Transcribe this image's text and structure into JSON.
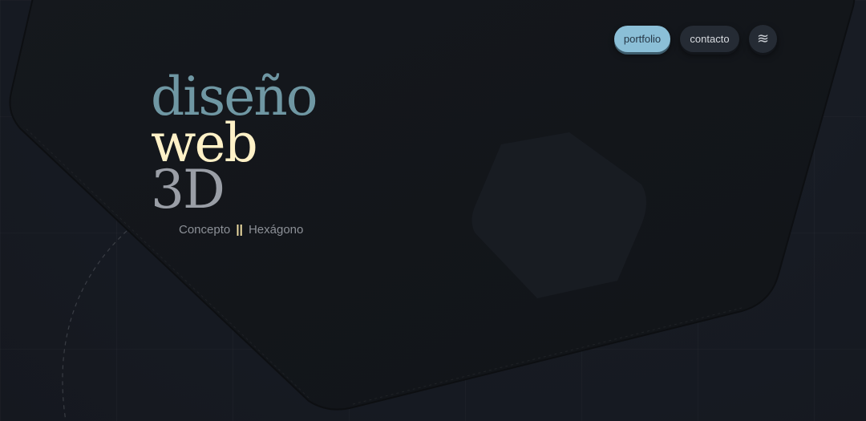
{
  "hero": {
    "line1": "diseño",
    "line2": "web",
    "line3": "3D"
  },
  "subtitle": {
    "left": "Concepto",
    "separator": "||",
    "right": "Hexágono"
  },
  "nav": {
    "portfolio_label": "portfolio",
    "contact_label": "contacto",
    "menu_icon": "≋"
  },
  "colors": {
    "background": "#181c24",
    "hexagon": "#14171c",
    "accent_blue": "#8bbfd7",
    "title_teal": "#6f97a3",
    "title_cream": "#fff1c7",
    "title_gray": "#9a9ea6"
  }
}
